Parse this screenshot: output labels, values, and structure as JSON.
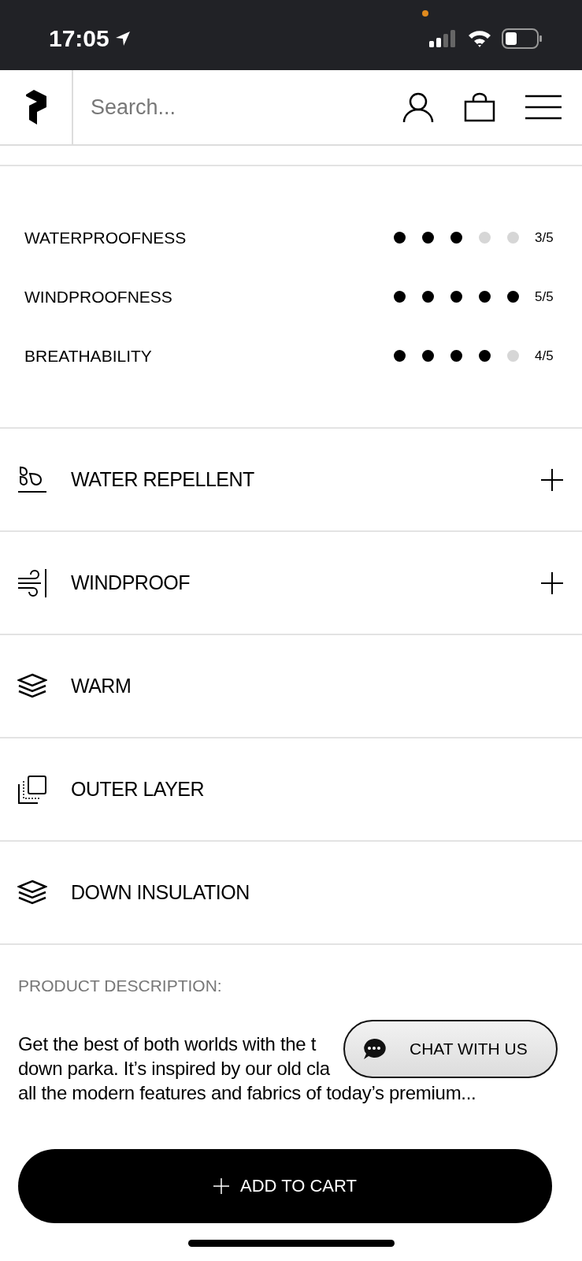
{
  "status_bar": {
    "time": "17:05"
  },
  "header": {
    "search": {
      "placeholder": "Search..."
    }
  },
  "ratings": [
    {
      "label": "WATERPROOFNESS",
      "stars": 3,
      "reading": "3/5"
    },
    {
      "label": "WINDPROOFNESS",
      "stars": 5,
      "reading": "5/5"
    },
    {
      "label": "BREATHABILITY",
      "stars": 4,
      "reading": "4/5"
    }
  ],
  "features": [
    {
      "kind": "drops",
      "label": "WATER REPELLENT",
      "expandable": true
    },
    {
      "kind": "wind",
      "label": "WINDPROOF",
      "expandable": true
    },
    {
      "kind": "layers",
      "label": "WARM",
      "expandable": false
    },
    {
      "kind": "squares",
      "label": "OUTER LAYER",
      "expandable": false
    },
    {
      "kind": "layers",
      "label": "DOWN INSULATION",
      "expandable": false
    }
  ],
  "description": {
    "title": "PRODUCT DESCRIPTION:",
    "lines": [
      "Get the best of both worlds with the t",
      "down parka. It’s inspired by our old cla",
      "all the modern features and fabrics of today’s premium..."
    ]
  },
  "chat_button": {
    "label": "CHAT WITH US"
  },
  "cart_button": {
    "label": "ADD TO CART"
  }
}
